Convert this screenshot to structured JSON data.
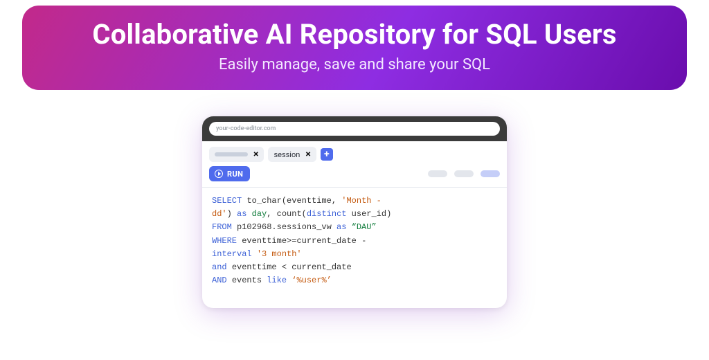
{
  "hero": {
    "title": "Collaborative AI Repository for SQL Users",
    "subtitle": "Easily manage, save and share your SQL"
  },
  "editor": {
    "url": "your-code-editor.com",
    "tab2_label": "session",
    "add_tab_glyph": "+",
    "run_label": "RUN",
    "code": {
      "kw_select": "SELECT",
      "fn_to_char": "to_char",
      "id_eventtime": "eventtime",
      "str_month_dd": "'Month -\ndd'",
      "kw_as1": "as",
      "alias_day": "day",
      "fn_count": "count",
      "kw_distinct": "distinct",
      "id_user_id": "user_id",
      "kw_from": "FROM",
      "id_table": "p102968.sessions_vw",
      "kw_as2": "as",
      "str_dau": "“DAU”",
      "kw_where": "WHERE",
      "id_eventtime2": "eventtime",
      "op_ge": ">=",
      "id_current_date": "current_date",
      "op_minus": "-",
      "kw_interval": "interval",
      "str_3month": "'3 month'",
      "kw_and1": "and",
      "id_eventtime3": "eventtime",
      "op_lt": "<",
      "id_current_date2": "current_date",
      "kw_and2": "AND",
      "id_events": "events",
      "kw_like": "like",
      "str_user_like": "‘%user%’"
    }
  }
}
